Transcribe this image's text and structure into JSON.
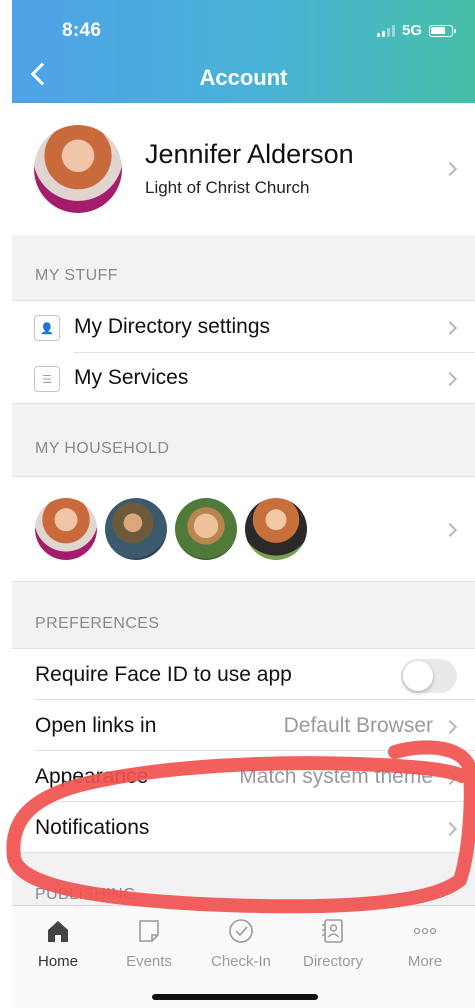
{
  "status_bar": {
    "time": "8:46",
    "network": "5G"
  },
  "header": {
    "title": "Account"
  },
  "profile": {
    "name": "Jennifer Alderson",
    "church": "Light of Christ Church"
  },
  "my_stuff": {
    "label": "MY STUFF",
    "items": [
      {
        "label": "My Directory settings",
        "icon": "directory-card-icon"
      },
      {
        "label": "My Services",
        "icon": "services-list-icon"
      }
    ]
  },
  "household": {
    "label": "MY HOUSEHOLD",
    "member_count": 4
  },
  "preferences": {
    "label": "PREFERENCES",
    "face_id": {
      "label": "Require Face ID to use app",
      "enabled": false
    },
    "open_links": {
      "label": "Open links in",
      "value": "Default Browser"
    },
    "appearance": {
      "label": "Appearance",
      "value": "Match system theme"
    },
    "notifications": {
      "label": "Notifications"
    }
  },
  "publishing": {
    "label": "PUBLISHING"
  },
  "tabs": [
    {
      "label": "Home",
      "icon": "home-icon",
      "active": true
    },
    {
      "label": "Events",
      "icon": "events-icon",
      "active": false
    },
    {
      "label": "Check-In",
      "icon": "check-in-icon",
      "active": false
    },
    {
      "label": "Directory",
      "icon": "directory-icon",
      "active": false
    },
    {
      "label": "More",
      "icon": "more-icon",
      "active": false
    }
  ],
  "colors": {
    "header_start": "#4fa2e8",
    "header_end": "#46bfa7",
    "annotation": "#f0524f"
  }
}
